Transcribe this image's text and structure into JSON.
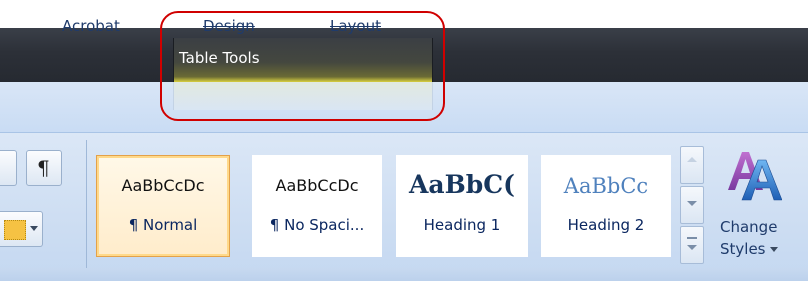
{
  "window": {
    "contextual_group_label": "Table Tools"
  },
  "tabs": {
    "acrobat": "Acrobat",
    "design": "Design",
    "layout": "Layout"
  },
  "paragraph": {
    "show_hide_symbol": "¶"
  },
  "styles_gallery": {
    "tiles": [
      {
        "preview": "AaBbCcDc",
        "name": "¶ Normal",
        "selected": true
      },
      {
        "preview": "AaBbCcDc",
        "name": "¶ No Spaci..."
      },
      {
        "preview": "AaBbC(",
        "name": "Heading 1"
      },
      {
        "preview": "AaBbCc",
        "name": "Heading 2"
      }
    ]
  },
  "change_styles": {
    "line1": "Change",
    "line2": "Styles"
  },
  "colors": {
    "annotation": "#d00000",
    "heading_blue": "#17365d",
    "accent_orange": "#e3a14a"
  },
  "icons": {
    "show_hide": "pilcrow-icon",
    "borders": "borders-icon",
    "change_styles": "change-styles-icon"
  }
}
